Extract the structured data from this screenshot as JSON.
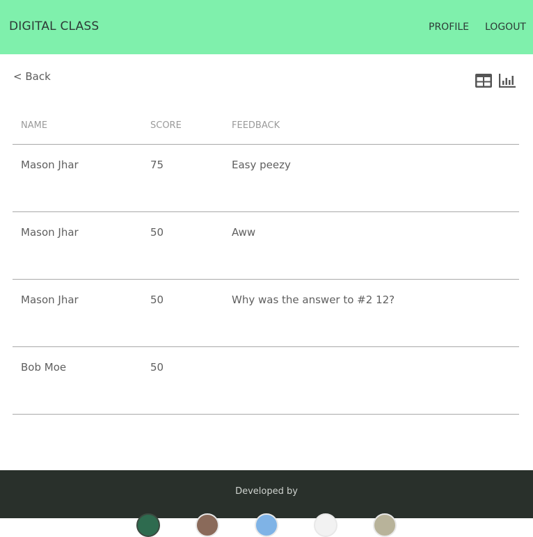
{
  "header": {
    "brand": "DIGITAL CLASS",
    "profile_label": "PROFILE",
    "logout_label": "LOGOUT"
  },
  "toolbar": {
    "back_label": "< Back",
    "table_view_icon": "table-grid-icon",
    "chart_view_icon": "bar-chart-icon"
  },
  "table": {
    "columns": [
      "NAME",
      "SCORE",
      "FEEDBACK"
    ],
    "rows": [
      {
        "name": "Mason Jhar",
        "score": "75",
        "feedback": "Easy peezy"
      },
      {
        "name": "Mason Jhar",
        "score": "50",
        "feedback": "Aww"
      },
      {
        "name": "Mason Jhar",
        "score": "50",
        "feedback": "Why was the answer to #2 12?"
      },
      {
        "name": "Bob Moe",
        "score": "50",
        "feedback": ""
      }
    ]
  },
  "footer": {
    "developed_by": "Developed by",
    "avatars": [
      "avatar-1",
      "avatar-2",
      "avatar-3",
      "avatar-4",
      "avatar-5"
    ]
  },
  "colors": {
    "navbar": "#7ff0ac",
    "footer": "#29302b",
    "icon": "#555555"
  }
}
